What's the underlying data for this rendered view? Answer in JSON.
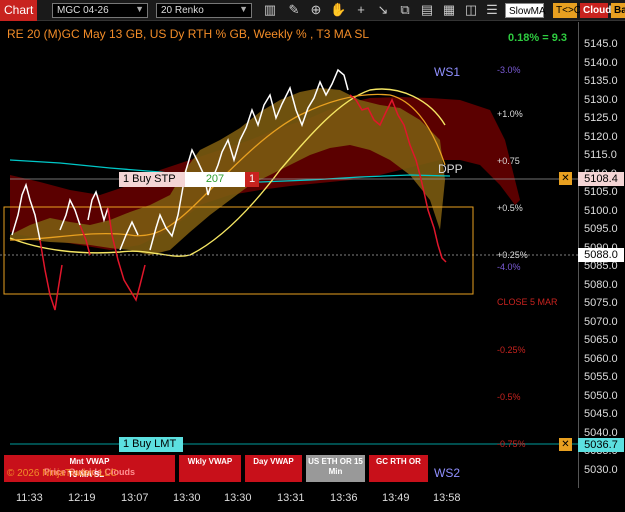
{
  "toolbar": {
    "chart_label": "Chart",
    "instrument": "MGC 04-26",
    "bar_type": "20 Renko",
    "slowma_label": "SlowMA",
    "tc_label": "T<>C",
    "cloud_label": "Cloud",
    "bar_label": "Bar"
  },
  "plot": {
    "title": "RE 20  (M)GC May 13 GB, US Dy RTH % GB, Weekly % , T3 MA SL",
    "pct_readout": "0.18% = 9.3",
    "level_labels": {
      "ws1": "WS1",
      "ws2": "WS2",
      "dpp": "DPP",
      "minus3": "-3.0%",
      "plus1": "+1.0%",
      "plus075": "+0.75",
      "plus05": "+0.5%",
      "plus025": "+0.25%",
      "minus4": "-4.0%",
      "close5mar": "CLOSE 5 MAR",
      "minus025": "-0.25%",
      "minus05": "-0.5%",
      "minus075": "-0.75%"
    }
  },
  "orders": {
    "stop": {
      "label": "1 Buy STP",
      "qty": "207",
      "count": "1",
      "price": "5108.4"
    },
    "limit": {
      "label": "1 Buy LMT",
      "price": "5036.7"
    }
  },
  "current_price": "5088.0",
  "y_ticks": [
    "5145.0",
    "5140.0",
    "5135.0",
    "5130.0",
    "5125.0",
    "5120.0",
    "5115.0",
    "5110.0",
    "5105.0",
    "5100.0",
    "5095.0",
    "5090.0",
    "5085.0",
    "5080.0",
    "5075.0",
    "5070.0",
    "5065.0",
    "5060.0",
    "5055.0",
    "5050.0",
    "5045.0",
    "5040.0",
    "5035.0",
    "5030.0"
  ],
  "x_ticks": [
    "11:33",
    "12:19",
    "13:07",
    "13:30",
    "13:30",
    "13:31",
    "13:36",
    "13:49",
    "13:58"
  ],
  "bottom_buttons": {
    "mnt_vwap": "Mnt VWAP",
    "t3_ma_sl": "T3 MA SL",
    "price_outside": "Price Outside Clouds",
    "copyright": "© 2026 NinjaTrader, LLC",
    "wkly_vwap": "Wkly VWAP",
    "day_vwap": "Day VWAP",
    "us_eth_or": "US ETH OR 15 Min",
    "gc_rth_or": "GC RTH OR"
  },
  "colors": {
    "chart_red": "#c8231f",
    "price_up": "#ffffff",
    "price_down": "#e0162b",
    "cloud_red": "#8b0000",
    "cloud_gold": "#8b6914",
    "cyan_line": "#00d0d0"
  }
}
